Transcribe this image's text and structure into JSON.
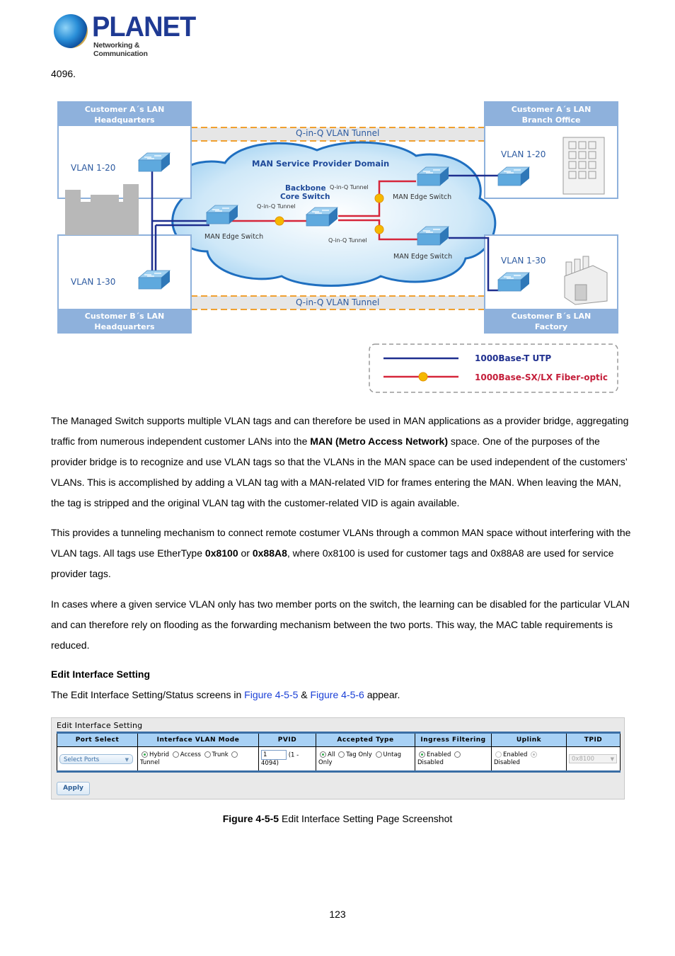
{
  "logo": {
    "brand": "PLANET",
    "tagline": "Networking & Communication"
  },
  "lead_fragment": "4096.",
  "diagram": {
    "boxes": {
      "a_hq": {
        "title_line1": "Customer A´s LAN",
        "title_line2": "Headquarters",
        "vlan": "VLAN 1-20"
      },
      "a_branch": {
        "title_line1": "Customer A´s LAN",
        "title_line2": "Branch Office",
        "vlan": "VLAN 1-20"
      },
      "b_hq": {
        "title_line1": "Customer B´s LAN",
        "title_line2": "Headquarters",
        "vlan": "VLAN 1-30"
      },
      "b_factory": {
        "title_line1": "Customer B´s LAN",
        "title_line2": "Factory",
        "vlan": "VLAN 1-30"
      }
    },
    "tunnel_top": "Q-in-Q VLAN Tunnel",
    "tunnel_bottom": "Q-in-Q VLAN Tunnel",
    "cloud_title": "MAN Service Provider Domain",
    "core_switch_line1": "Backbone",
    "core_switch_line2": "Core Switch",
    "edge_switch_label": "MAN Edge Switch",
    "qinq_tunnel_label": "Q-in-Q Tunnel",
    "legend": {
      "utp": "1000Base-T UTP",
      "fiber": "1000Base-SX/LX Fiber-optic",
      "colors": {
        "utp": "#1f2f8f",
        "fiber": "#d6263a"
      }
    }
  },
  "paragraphs": {
    "p1": {
      "a": "The Managed Switch supports multiple VLAN tags and can therefore be used in MAN applications as a provider bridge, aggregating traffic from numerous independent customer LANs into the ",
      "bold": "MAN (Metro Access Network)",
      "b": " space. One of the purposes of the provider bridge is to recognize and use VLAN tags so that the VLANs in the MAN space can be used independent of the customers’ VLANs. This is accomplished by adding a VLAN tag with a MAN-related VID for frames entering the MAN. When leaving the MAN, the tag is stripped and the original VLAN tag with the customer-related VID is again available."
    },
    "p2": {
      "a": "This provides a tunneling mechanism to connect remote costumer VLANs through a common MAN space without interfering with the VLAN tags. All tags use EtherType ",
      "bold1": "0x8100",
      "b": " or ",
      "bold2": "0x88A8",
      "c": ", where 0x8100 is used for customer tags and 0x88A8 are used for service provider tags."
    },
    "p3": "In cases where a given service VLAN only has two member ports on the switch, the learning can be disabled for the particular VLAN and can therefore rely on flooding as the forwarding mechanism between the two ports. This way, the MAC table requirements is reduced."
  },
  "section_heading": "Edit Interface Setting",
  "intro": {
    "a": "The Edit Interface Setting/Status screens in ",
    "link1": "Figure 4-5-5",
    "b": " & ",
    "link2": "Figure 4-5-6",
    "c": " appear."
  },
  "panel": {
    "title": "Edit Interface Setting",
    "columns": [
      "Port Select",
      "Interface VLAN Mode",
      "PVID",
      "Accepted Type",
      "Ingress Filtering",
      "Uplink",
      "TPID"
    ],
    "port_select": "Select Ports",
    "vlan_mode": {
      "options": [
        "Hybrid",
        "Access",
        "Trunk",
        "Tunnel"
      ],
      "selected": "Hybrid"
    },
    "pvid": {
      "value": "1",
      "range": "(1 - 4094)"
    },
    "accepted_type": {
      "options": [
        "All",
        "Tag Only",
        "Untag Only"
      ],
      "selected": "All"
    },
    "ingress_filtering": {
      "options": [
        "Enabled",
        "Disabled"
      ],
      "selected": "Enabled"
    },
    "uplink": {
      "options": [
        "Enabled",
        "Disabled"
      ],
      "selected": "Disabled",
      "disabled": true
    },
    "tpid": {
      "value": "0x8100",
      "disabled": true
    },
    "apply_label": "Apply",
    "colors": {
      "header_bg": "#a8d1f5",
      "border_accent": "#3a6ea5",
      "radio_on": "#2fa84a"
    }
  },
  "caption": {
    "bold": "Figure 4-5-5",
    "text": " Edit Interface Setting Page Screenshot"
  },
  "page_number": "123"
}
